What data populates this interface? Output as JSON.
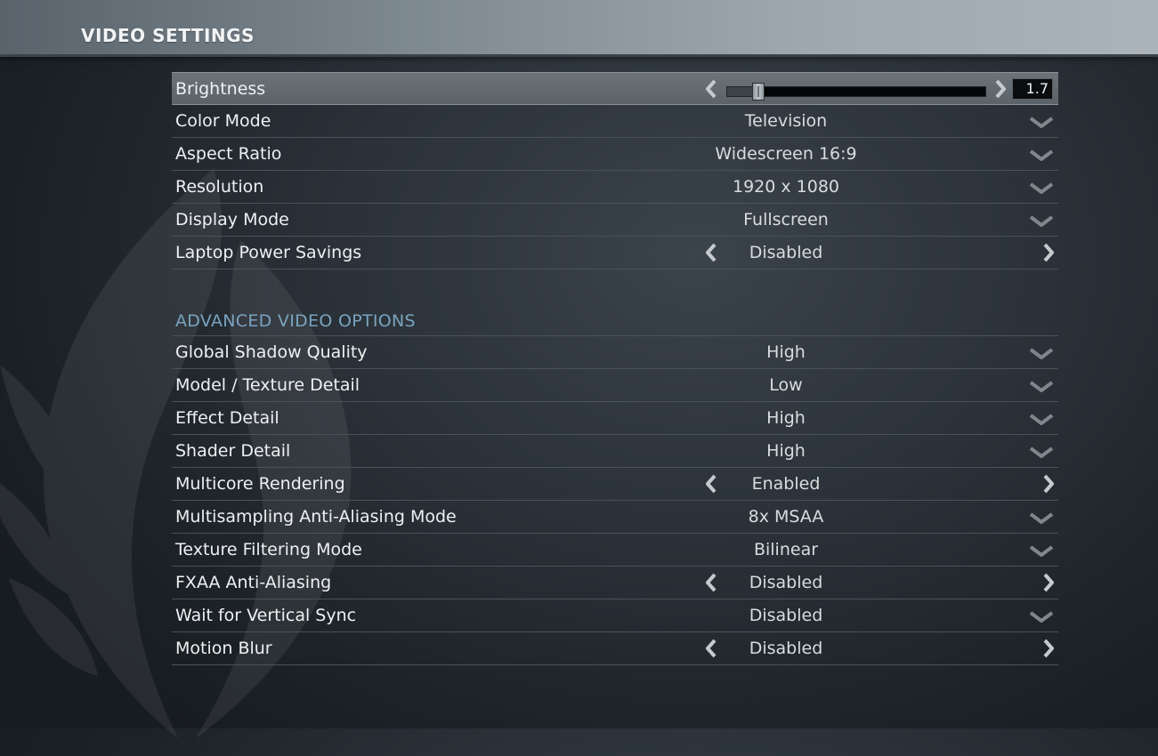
{
  "header": {
    "title": "VIDEO SETTINGS"
  },
  "brightness": {
    "label": "Brightness",
    "value": "1.7",
    "slider_fraction": 0.12
  },
  "basic_settings": [
    {
      "label": "Color Mode",
      "value": "Television",
      "control": "dropdown"
    },
    {
      "label": "Aspect Ratio",
      "value": "Widescreen 16:9",
      "control": "dropdown"
    },
    {
      "label": "Resolution",
      "value": "1920 x 1080",
      "control": "dropdown"
    },
    {
      "label": "Display Mode",
      "value": "Fullscreen",
      "control": "dropdown"
    },
    {
      "label": "Laptop Power Savings",
      "value": "Disabled",
      "control": "toggle"
    }
  ],
  "advanced": {
    "header": "ADVANCED VIDEO OPTIONS",
    "settings": [
      {
        "label": "Global Shadow Quality",
        "value": "High",
        "control": "dropdown"
      },
      {
        "label": "Model / Texture Detail",
        "value": "Low",
        "control": "dropdown"
      },
      {
        "label": "Effect Detail",
        "value": "High",
        "control": "dropdown"
      },
      {
        "label": "Shader Detail",
        "value": "High",
        "control": "dropdown"
      },
      {
        "label": "Multicore Rendering",
        "value": "Enabled",
        "control": "toggle"
      },
      {
        "label": "Multisampling Anti-Aliasing Mode",
        "value": "8x MSAA",
        "control": "dropdown"
      },
      {
        "label": "Texture Filtering Mode",
        "value": "Bilinear",
        "control": "dropdown"
      },
      {
        "label": "FXAA Anti-Aliasing",
        "value": "Disabled",
        "control": "toggle"
      },
      {
        "label": "Wait for Vertical Sync",
        "value": "Disabled",
        "control": "dropdown"
      },
      {
        "label": "Motion Blur",
        "value": "Disabled",
        "control": "toggle"
      }
    ]
  },
  "colors": {
    "section_header": "#7aa3bf",
    "selected_row": "#656d73"
  },
  "icons": {
    "dropdown": "chevron-down-icon",
    "previous": "chevron-left-icon",
    "next": "chevron-right-icon"
  }
}
